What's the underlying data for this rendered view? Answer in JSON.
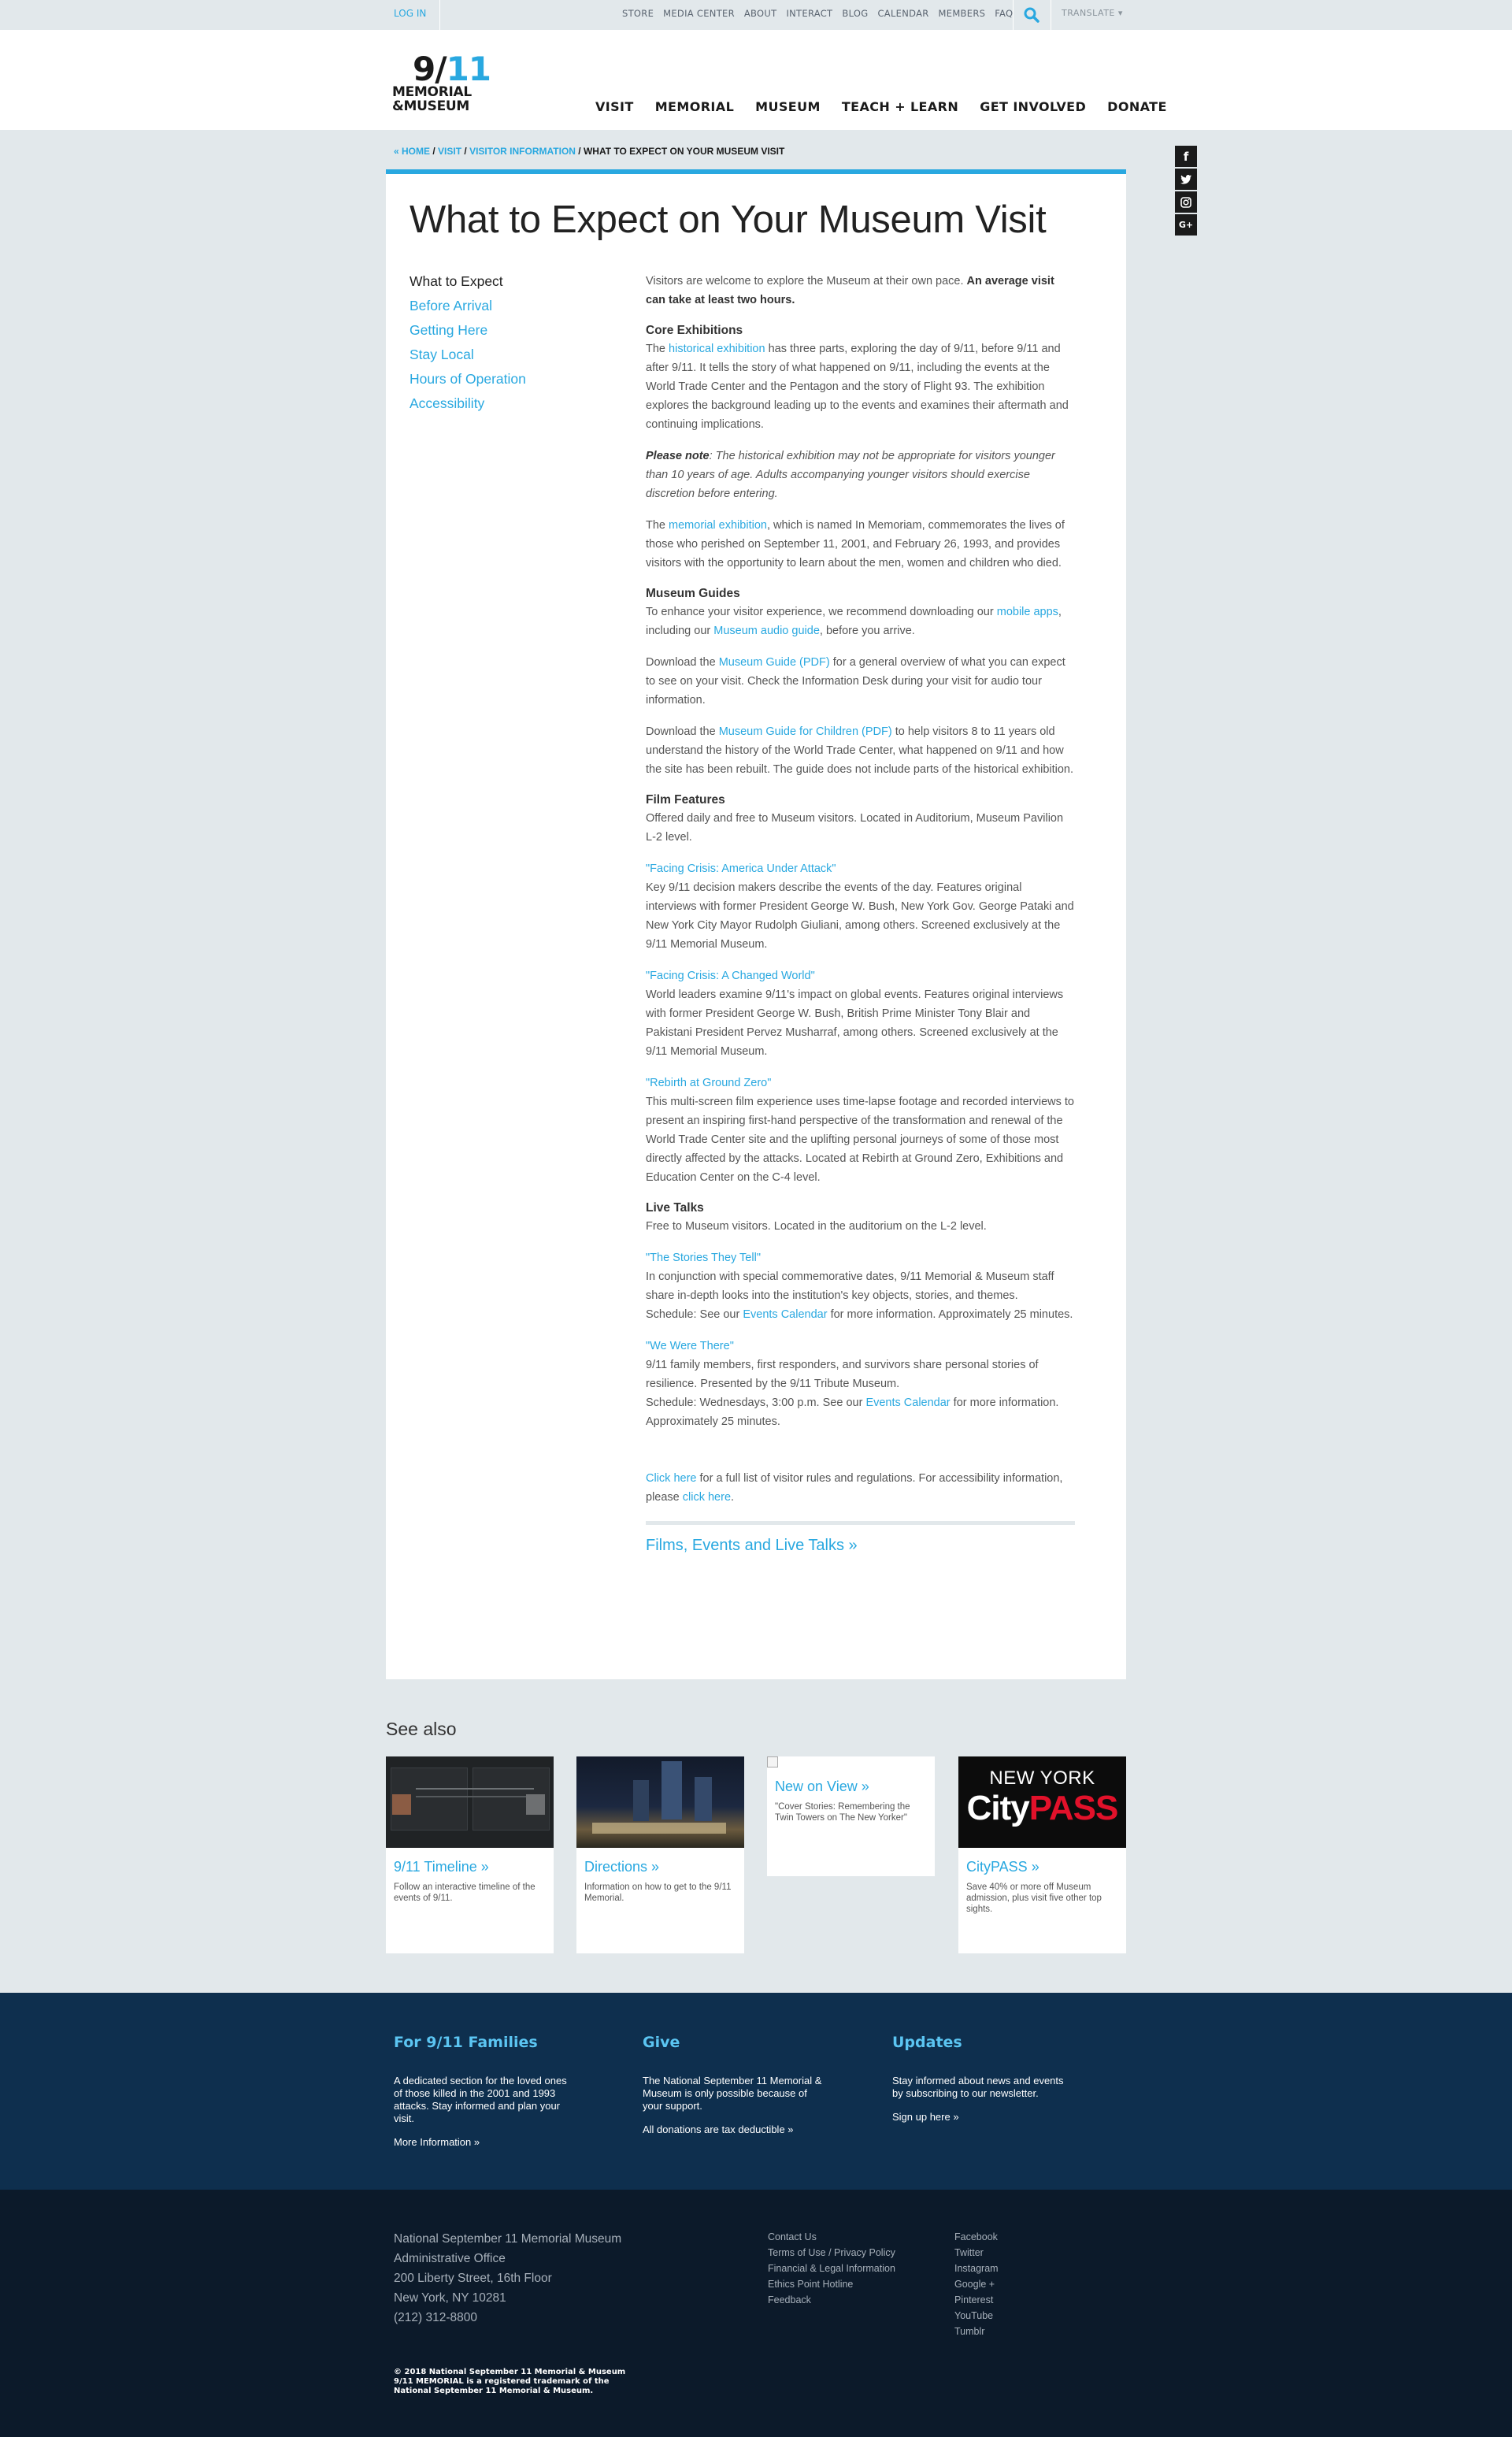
{
  "utility": {
    "login": "LOG IN",
    "links": [
      "STORE",
      "MEDIA CENTER",
      "ABOUT",
      "INTERACT",
      "BLOG",
      "CALENDAR",
      "MEMBERS",
      "FAQ"
    ],
    "translate": "TRANSLATE ▾"
  },
  "logo": {
    "number_a": "9/",
    "number_b": "11",
    "line1": "MEMORIAL",
    "line2": "&MUSEUM"
  },
  "nav": [
    "VISIT",
    "MEMORIAL",
    "MUSEUM",
    "TEACH + LEARN",
    "GET INVOLVED",
    "DONATE"
  ],
  "breadcrumb": {
    "home": "« HOME",
    "visit": "VISIT",
    "info": "VISITOR INFORMATION",
    "current": "WHAT TO EXPECT ON YOUR MUSEUM VISIT",
    "sep": " / "
  },
  "social": [
    "f",
    "t",
    "◎",
    "G+"
  ],
  "page": {
    "title": "What to Expect on Your Museum Visit",
    "sidenav": [
      {
        "label": "What to Expect",
        "current": true
      },
      {
        "label": "Before Arrival"
      },
      {
        "label": "Getting Here"
      },
      {
        "label": "Stay Local"
      },
      {
        "label": "Hours of Operation"
      },
      {
        "label": "Accessibility"
      }
    ]
  },
  "content": {
    "intro": "Visitors are welcome to explore the Museum at their own pace.",
    "intro_bold": "An average visit can take at least two hours.",
    "core_h": "Core Exhibitions",
    "core_a": "The",
    "core_link": "historical exhibition",
    "core_b": "has three parts, exploring the day of 9/11, before 9/11 and after 9/11. It tells the story of what happened on 9/11, including the events at the World Trade Center and the Pentagon and the story of Flight 93. The exhibition explores the background leading up to the events and examines their aftermath and continuing implications.",
    "note_b": "Please note",
    "note_i": ": The historical exhibition may not be appropriate for visitors younger than 10 years of age. Adults accompanying younger visitors should exercise discretion before entering.",
    "mem_a": "The",
    "mem_link": "memorial exhibition",
    "mem_b": ", which is named In Memoriam, commemorates the lives of those who perished on September 11, 2001, and February 26, 1993, and provides visitors with the opportunity to learn about the men, women and children who died.",
    "guides_h": "Museum Guides",
    "guides_a": "To enhance your visitor experience, we recommend downloading our",
    "guides_link1": "mobile apps",
    "guides_b": ", including our",
    "guides_link2": "Museum audio guide",
    "guides_c": ", before you arrive.",
    "dl1_a": "Download the",
    "dl1_link": "Museum Guide (PDF)",
    "dl1_b": "for a general overview of what you can expect to see on your visit. Check the Information Desk during your visit for audio tour information.",
    "dl2_a": "Download the",
    "dl2_link": "Museum Guide for Children (PDF)",
    "dl2_b": "to help visitors 8 to 11 years old understand the history of the World Trade Center, what happened on 9/11 and how the site has been rebuilt. The guide does not include parts of the historical exhibition.",
    "film_h": "Film Features",
    "film_p": "Offered daily and free to Museum visitors. Located in Auditorium, Museum Pavilion L-2 level.",
    "film1_t": "\"Facing Crisis: America Under Attack\"",
    "film1_p": "Key 9/11 decision makers describe the events of the day. Features original interviews with former President George W. Bush, New York Gov. George Pataki and New York City Mayor Rudolph Giuliani, among others. Screened exclusively at the 9/11 Memorial Museum.",
    "film2_t": "\"Facing Crisis: A Changed World\"",
    "film2_p": "World leaders examine 9/11's impact on global events. Features original interviews with former President George W. Bush, British Prime Minister Tony Blair and Pakistani President Pervez Musharraf, among others. Screened exclusively at the 9/11 Memorial Museum.",
    "film3_t": "\"Rebirth at Ground Zero\"",
    "film3_p": "This multi-screen film experience uses time-lapse footage and recorded interviews to present an inspiring first-hand perspective of the transformation and renewal of the World Trade Center site and the uplifting personal journeys of some of those most directly affected by the attacks. Located at Rebirth at Ground Zero, Exhibitions and Education Center on the C-4 level.",
    "talks_h": "Live Talks",
    "talks_p": "Free to Museum visitors. Located in the auditorium on the L-2 level.",
    "talk1_t": "\"The Stories They Tell\"",
    "talk1_p": "In conjunction with special commemorative dates, 9/11 Memorial & Museum staff share in-depth looks into the institution's key objects, stories, and themes.",
    "talk1_s_a": "Schedule: See our",
    "talk1_s_link": "Events Calendar",
    "talk1_s_b": "for more information. Approximately 25 minutes.",
    "talk2_t": "\"We Were There\"",
    "talk2_p": "9/11 family members, first responders, and survivors share personal stories of resilience. Presented by the 9/11 Tribute Museum.",
    "talk2_s_a": "Schedule: Wednesdays, 3:00 p.m. See our",
    "talk2_s_link": "Events Calendar",
    "talk2_s_b": "for more information. Approximately 25 minutes.",
    "rules_link": "Click here",
    "rules_a": "for a full list of visitor rules and regulations. For accessibility information, please",
    "rules_link2": "click here",
    "rules_b": ".",
    "films_link": "Films, Events and Live Talks »"
  },
  "see_also": {
    "heading": "See also",
    "tiles": [
      {
        "title": "9/11 Timeline »",
        "desc": "Follow an interactive timeline of the events of 9/11."
      },
      {
        "title": "Directions »",
        "desc": "Information on how to get to the 9/11 Memorial."
      },
      {
        "title": "New on View »",
        "desc": "\"Cover Stories: Remembering the Twin Towers on The New Yorker\""
      },
      {
        "title": "CityPASS »",
        "desc": "Save 40% or more off Museum admission, plus visit five other top sights.",
        "img_top": "NEW YORK",
        "img_a": "City",
        "img_b": "PASS"
      }
    ]
  },
  "promo": [
    {
      "title": "For 9/11 Families",
      "text": "A dedicated section for the loved ones of those killed in the 2001 and 1993 attacks. Stay informed and plan your visit.",
      "link": "More Information »"
    },
    {
      "title": "Give",
      "text": "The National September 11 Memorial & Museum is only possible because of your support.",
      "link": "All donations are tax deductible »"
    },
    {
      "title": "Updates",
      "text": "Stay informed about news and events by subscribing to our newsletter.",
      "link": "Sign up here »"
    }
  ],
  "footer": {
    "address": [
      "National September 11 Memorial Museum",
      "Administrative Office",
      "200 Liberty Street, 16th Floor",
      "New York, NY 10281",
      "(212) 312-8800"
    ],
    "links": [
      "Contact Us",
      "Terms of Use / Privacy Policy",
      "Financial & Legal Information",
      "Ethics Point Hotline",
      "Feedback"
    ],
    "social": [
      "Facebook",
      "Twitter",
      "Instagram",
      "Google +",
      "Pinterest",
      "YouTube",
      "Tumblr"
    ],
    "copyright": [
      "© 2018 National September 11 Memorial & Museum",
      "9/11 MEMORIAL is a registered trademark of the",
      "National September 11 Memorial & Museum."
    ]
  },
  "colors": {
    "accent": "#29a8e0",
    "page_bg": "#e2e8eb",
    "promo_bg": "#0e2f4e",
    "footer_bg": "#0c1a2a"
  }
}
